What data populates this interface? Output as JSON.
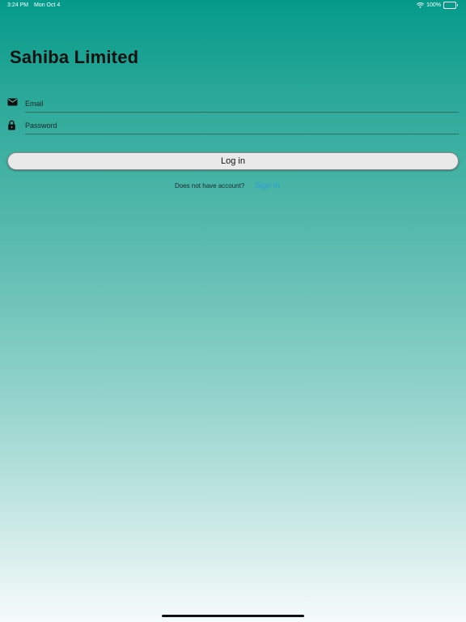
{
  "status_bar": {
    "time": "3:24 PM",
    "date": "Mon Oct 4",
    "battery": "100%"
  },
  "app": {
    "title": "Sahiba Limited"
  },
  "form": {
    "email_placeholder": "Email",
    "password_placeholder": "Password",
    "login_label": "Log in"
  },
  "signup": {
    "prompt": "Does not have account?",
    "link_label": "Sign in"
  },
  "colors": {
    "gradient_top": "#049a8a",
    "gradient_bottom": "#f6fbfb",
    "link": "#2d9cdb",
    "button_bg": "#e9e9e9"
  },
  "icons": {
    "email": "envelope-icon",
    "password": "lock-icon",
    "wifi": "wifi-icon",
    "battery": "battery-icon"
  }
}
